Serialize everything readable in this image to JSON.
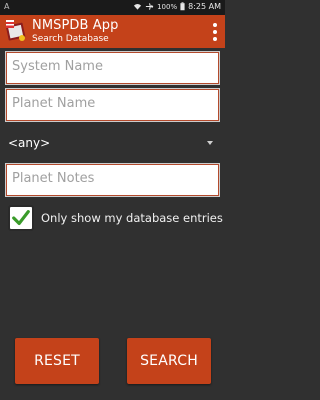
{
  "status_bar": {
    "left_text": "A",
    "battery": "100%",
    "time": "8:25 AM"
  },
  "app_bar": {
    "title": "NMSPDB App",
    "subtitle": "Search Database"
  },
  "form": {
    "system_name_placeholder": "System Name",
    "planet_name_placeholder": "Planet Name",
    "type_selected": "<any>",
    "planet_notes_placeholder": "Planet Notes",
    "only_mine_label": "Only show my database entries",
    "only_mine_checked": true
  },
  "buttons": {
    "reset_label": "RESET",
    "search_label": "SEARCH"
  },
  "colors": {
    "accent": "#c4421a",
    "background": "#303030",
    "status_bar": "#1a1a1a"
  }
}
